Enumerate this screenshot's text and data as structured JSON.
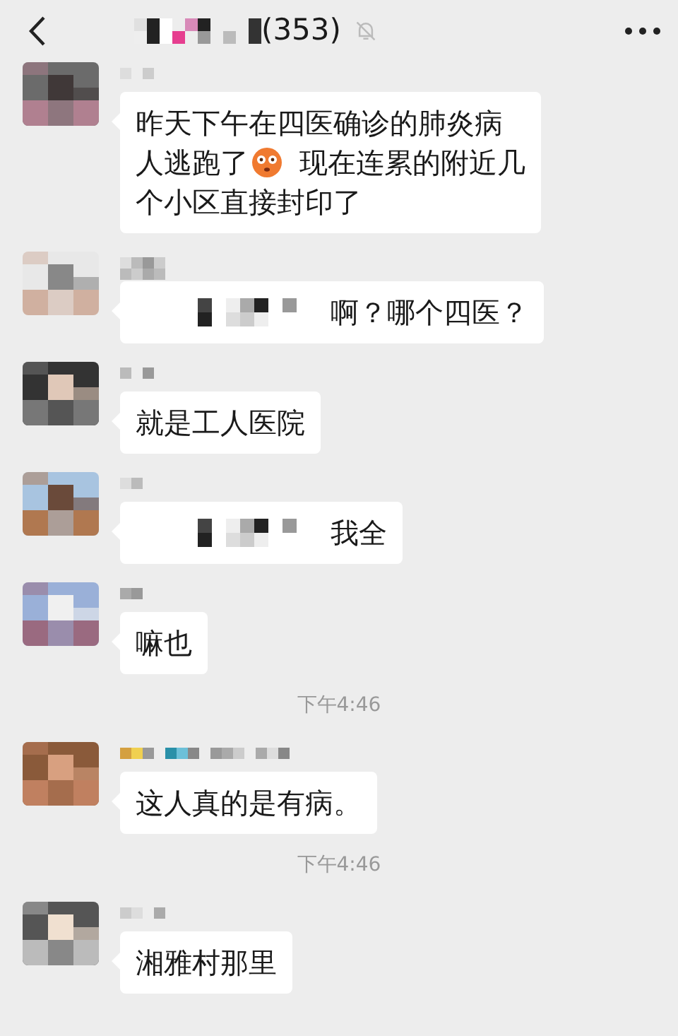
{
  "header": {
    "count": "(353)",
    "muted": true
  },
  "messages": [
    {
      "kind": "message",
      "lines": [
        [
          {
            "kind": "text",
            "text": "昨天下午在四医确诊的肺炎病"
          }
        ],
        [
          {
            "kind": "text",
            "text": "人逃跑了"
          },
          {
            "kind": "emoji"
          },
          {
            "kind": "text",
            "text": "现在连累的附近几"
          }
        ],
        [
          {
            "kind": "text",
            "text": "个小区直接封印了"
          }
        ]
      ]
    },
    {
      "kind": "message",
      "lines": [
        [
          {
            "kind": "mosaic"
          },
          {
            "kind": "text",
            "text": "啊？哪个四医？"
          }
        ]
      ]
    },
    {
      "kind": "message",
      "lines": [
        [
          {
            "kind": "text",
            "text": "就是工人医院"
          }
        ]
      ]
    },
    {
      "kind": "message",
      "lines": [
        [
          {
            "kind": "mosaic"
          },
          {
            "kind": "text",
            "text": "我全"
          }
        ]
      ]
    },
    {
      "kind": "message",
      "lines": [
        [
          {
            "kind": "text",
            "text": "嘛也"
          }
        ]
      ]
    },
    {
      "kind": "time",
      "text": "下午4:46"
    },
    {
      "kind": "message",
      "lines": [
        [
          {
            "kind": "text",
            "text": "这人真的是有病。"
          }
        ]
      ]
    },
    {
      "kind": "time",
      "text": "下午4:46"
    },
    {
      "kind": "message",
      "lines": [
        [
          {
            "kind": "text",
            "text": "湘雅村那里"
          }
        ]
      ]
    }
  ]
}
